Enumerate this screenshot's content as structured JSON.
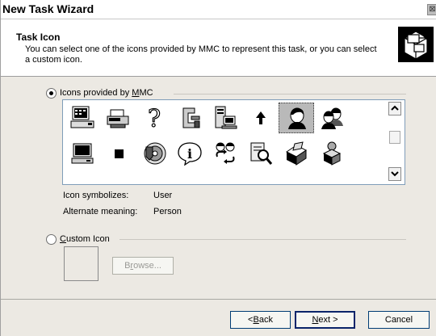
{
  "window": {
    "title": "New Task Wizard",
    "close_symbol": "⊠"
  },
  "header": {
    "title": "Task Icon",
    "description": "You can select one of the icons provided by MMC to represent this task, or you can select a custom icon.",
    "icon": "task-icon"
  },
  "mmc_group": {
    "label_pre": "Icons provided by ",
    "label_hotkey": "M",
    "label_post": "MC",
    "selected": true,
    "icons": [
      "calendar-computer-icon",
      "printer-computer-icon",
      "question-mark-icon",
      "clamp-icon",
      "server-computer-icon",
      "up-arrow-icon",
      "user-icon",
      "users-icon",
      "computer-monitor-icon",
      "black-square-icon",
      "cd-disc-icon",
      "info-icon",
      "users-refresh-icon",
      "search-document-icon",
      "box-icon",
      "shapes-icon"
    ],
    "selected_icon_index": 6,
    "symbolizes_label": "Icon symbolizes:",
    "symbolizes_value": "User",
    "alternate_label": "Alternate meaning:",
    "alternate_value": "Person"
  },
  "custom_group": {
    "label_hotkey": "C",
    "label_post": "ustom Icon",
    "selected": false,
    "browse_pre": "B",
    "browse_hotkey": "r",
    "browse_post": "owse..."
  },
  "buttons": {
    "back_pre": "< ",
    "back_hotkey": "B",
    "back_post": "ack",
    "next_hotkey": "N",
    "next_post": "ext >",
    "cancel": "Cancel"
  }
}
